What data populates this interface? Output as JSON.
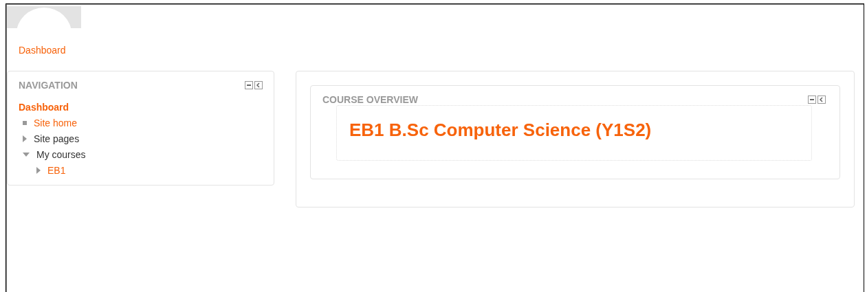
{
  "breadcrumb": "Dashboard",
  "navigation": {
    "title": "NAVIGATION",
    "items": [
      {
        "label": "Dashboard",
        "kind": "current",
        "link": true,
        "children": [
          {
            "label": "Site home",
            "kind": "leaf",
            "link": true
          },
          {
            "label": "Site pages",
            "kind": "branch",
            "link": false,
            "expanded": false
          },
          {
            "label": "My courses",
            "kind": "branch",
            "link": false,
            "expanded": true,
            "children": [
              {
                "label": "EB1",
                "kind": "branch",
                "link": true,
                "expanded": false
              }
            ]
          }
        ]
      }
    ]
  },
  "course_overview": {
    "title": "COURSE OVERVIEW",
    "courses": [
      "EB1 B.Sc Computer Science (Y1S2)"
    ]
  }
}
